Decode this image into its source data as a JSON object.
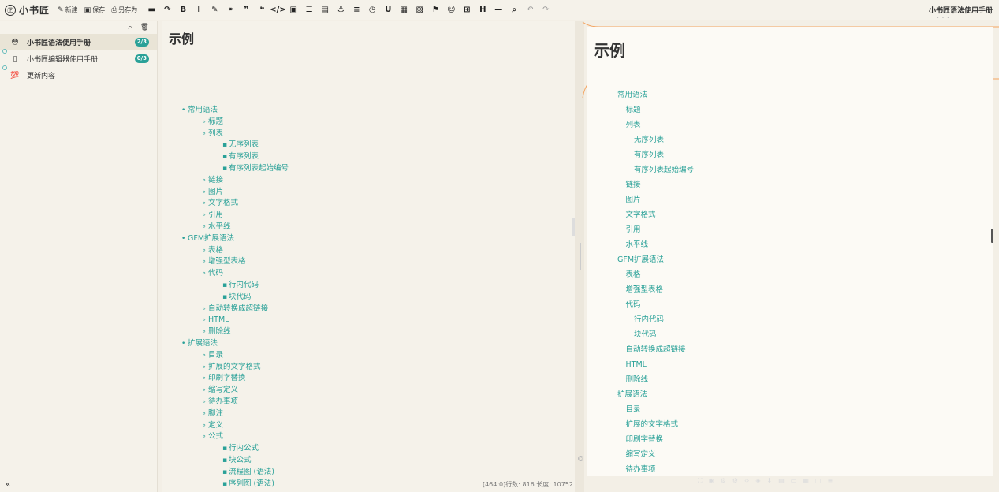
{
  "app": {
    "logo_glyph": "㊣",
    "brand": "小书匠",
    "doc_title": "小书匠语法使用手册"
  },
  "toolbar": {
    "new_label": "新建",
    "save_label": "保存",
    "saveas_label": "另存为",
    "icons": [
      {
        "name": "keyboard-icon",
        "glyph": "▬"
      },
      {
        "name": "redo-icon",
        "glyph": "↷"
      },
      {
        "name": "bold-icon",
        "glyph": "B"
      },
      {
        "name": "italic-icon",
        "glyph": "I"
      },
      {
        "name": "brush-icon",
        "glyph": "✎"
      },
      {
        "name": "link-icon",
        "glyph": "⚭"
      },
      {
        "name": "quote-close-icon",
        "glyph": "❞"
      },
      {
        "name": "quote-open-icon",
        "glyph": "❝"
      },
      {
        "name": "code-icon",
        "glyph": "</>"
      },
      {
        "name": "image-icon",
        "glyph": "▣"
      },
      {
        "name": "unordered-list-icon",
        "glyph": "☰"
      },
      {
        "name": "ordered-list-icon",
        "glyph": "▤"
      },
      {
        "name": "anchor-icon",
        "glyph": "⚓"
      },
      {
        "name": "align-icon",
        "glyph": "≡"
      },
      {
        "name": "clock-icon",
        "glyph": "◷"
      },
      {
        "name": "underline-icon",
        "glyph": "U"
      },
      {
        "name": "table-edit-icon",
        "glyph": "▦"
      },
      {
        "name": "table-remove-icon",
        "glyph": "▧"
      },
      {
        "name": "flag-icon",
        "glyph": "⚑"
      },
      {
        "name": "smile-icon",
        "glyph": "☺"
      },
      {
        "name": "table-icon",
        "glyph": "⊞"
      },
      {
        "name": "heading-icon",
        "glyph": "H"
      },
      {
        "name": "horizontal-rule-icon",
        "glyph": "—"
      },
      {
        "name": "find-replace-icon",
        "glyph": "⌕"
      },
      {
        "name": "undo-icon",
        "glyph": "↶",
        "light": true
      },
      {
        "name": "redo-light-icon",
        "glyph": "↷",
        "light": true
      }
    ]
  },
  "sidebar": {
    "search_glyph": "⌕",
    "trash_glyph": "🗑",
    "collapse_glyph": "«",
    "items": [
      {
        "label": "小书匠语法使用手册",
        "emoji": "😳",
        "badge": "2/3",
        "active": true
      },
      {
        "label": "小书匠编辑器使用手册",
        "emoji": "▯",
        "badge": "0/3",
        "active": false
      },
      {
        "label": "更新内容",
        "emoji": "💯",
        "badge": "",
        "active": false
      }
    ]
  },
  "editor": {
    "heading": "示例",
    "status": "[464:0]行数: 816 长度: 10752",
    "list": [
      {
        "text": "常用语法",
        "level": 0
      },
      {
        "text": "标题",
        "level": 1
      },
      {
        "text": "列表",
        "level": 1
      },
      {
        "text": "无序列表",
        "level": 2
      },
      {
        "text": "有序列表",
        "level": 2
      },
      {
        "text": "有序列表起始编号",
        "level": 2
      },
      {
        "text": "链接",
        "level": 1
      },
      {
        "text": "图片",
        "level": 1
      },
      {
        "text": "文字格式",
        "level": 1
      },
      {
        "text": "引用",
        "level": 1
      },
      {
        "text": "水平线",
        "level": 1
      },
      {
        "text": "GFM扩展语法",
        "level": 0
      },
      {
        "text": "表格",
        "level": 1
      },
      {
        "text": "增强型表格",
        "level": 1
      },
      {
        "text": "代码",
        "level": 1
      },
      {
        "text": "行内代码",
        "level": 2
      },
      {
        "text": "块代码",
        "level": 2
      },
      {
        "text": "自动转换成超链接",
        "level": 1
      },
      {
        "text": "HTML",
        "level": 1
      },
      {
        "text": "删除线",
        "level": 1
      },
      {
        "text": "扩展语法",
        "level": 0
      },
      {
        "text": "目录",
        "level": 1
      },
      {
        "text": "扩展的文字格式",
        "level": 1
      },
      {
        "text": "印刷字替换",
        "level": 1
      },
      {
        "text": "缩写定义",
        "level": 1
      },
      {
        "text": "待办事项",
        "level": 1
      },
      {
        "text": "脚注",
        "level": 1
      },
      {
        "text": "定义",
        "level": 1
      },
      {
        "text": "公式",
        "level": 1
      },
      {
        "text": "行内公式",
        "level": 2
      },
      {
        "text": "块公式",
        "level": 2
      },
      {
        "text": "流程图 (语法)",
        "level": 2
      },
      {
        "text": "序列图 (语法)",
        "level": 2
      }
    ]
  },
  "preview": {
    "heading": "示例",
    "list": [
      {
        "text": "常用语法",
        "level": 0
      },
      {
        "text": "标题",
        "level": 1
      },
      {
        "text": "列表",
        "level": 1
      },
      {
        "text": "无序列表",
        "level": 2
      },
      {
        "text": "有序列表",
        "level": 2
      },
      {
        "text": "有序列表起始编号",
        "level": 2
      },
      {
        "text": "链接",
        "level": 1
      },
      {
        "text": "图片",
        "level": 1
      },
      {
        "text": "文字格式",
        "level": 1
      },
      {
        "text": "引用",
        "level": 1
      },
      {
        "text": "水平线",
        "level": 1
      },
      {
        "text": "GFM扩展语法",
        "level": 0
      },
      {
        "text": "表格",
        "level": 1
      },
      {
        "text": "增强型表格",
        "level": 1
      },
      {
        "text": "代码",
        "level": 1
      },
      {
        "text": "行内代码",
        "level": 2
      },
      {
        "text": "块代码",
        "level": 2
      },
      {
        "text": "自动转换成超链接",
        "level": 1
      },
      {
        "text": "HTML",
        "level": 1
      },
      {
        "text": "删除线",
        "level": 1
      },
      {
        "text": "扩展语法",
        "level": 0
      },
      {
        "text": "目录",
        "level": 1
      },
      {
        "text": "扩展的文字格式",
        "level": 1
      },
      {
        "text": "印刷字替换",
        "level": 1
      },
      {
        "text": "缩写定义",
        "level": 1
      },
      {
        "text": "待办事项",
        "level": 1
      }
    ]
  },
  "colors": {
    "accent": "#2aa198",
    "background": "#f3efe6",
    "curve": "#f4a460"
  }
}
